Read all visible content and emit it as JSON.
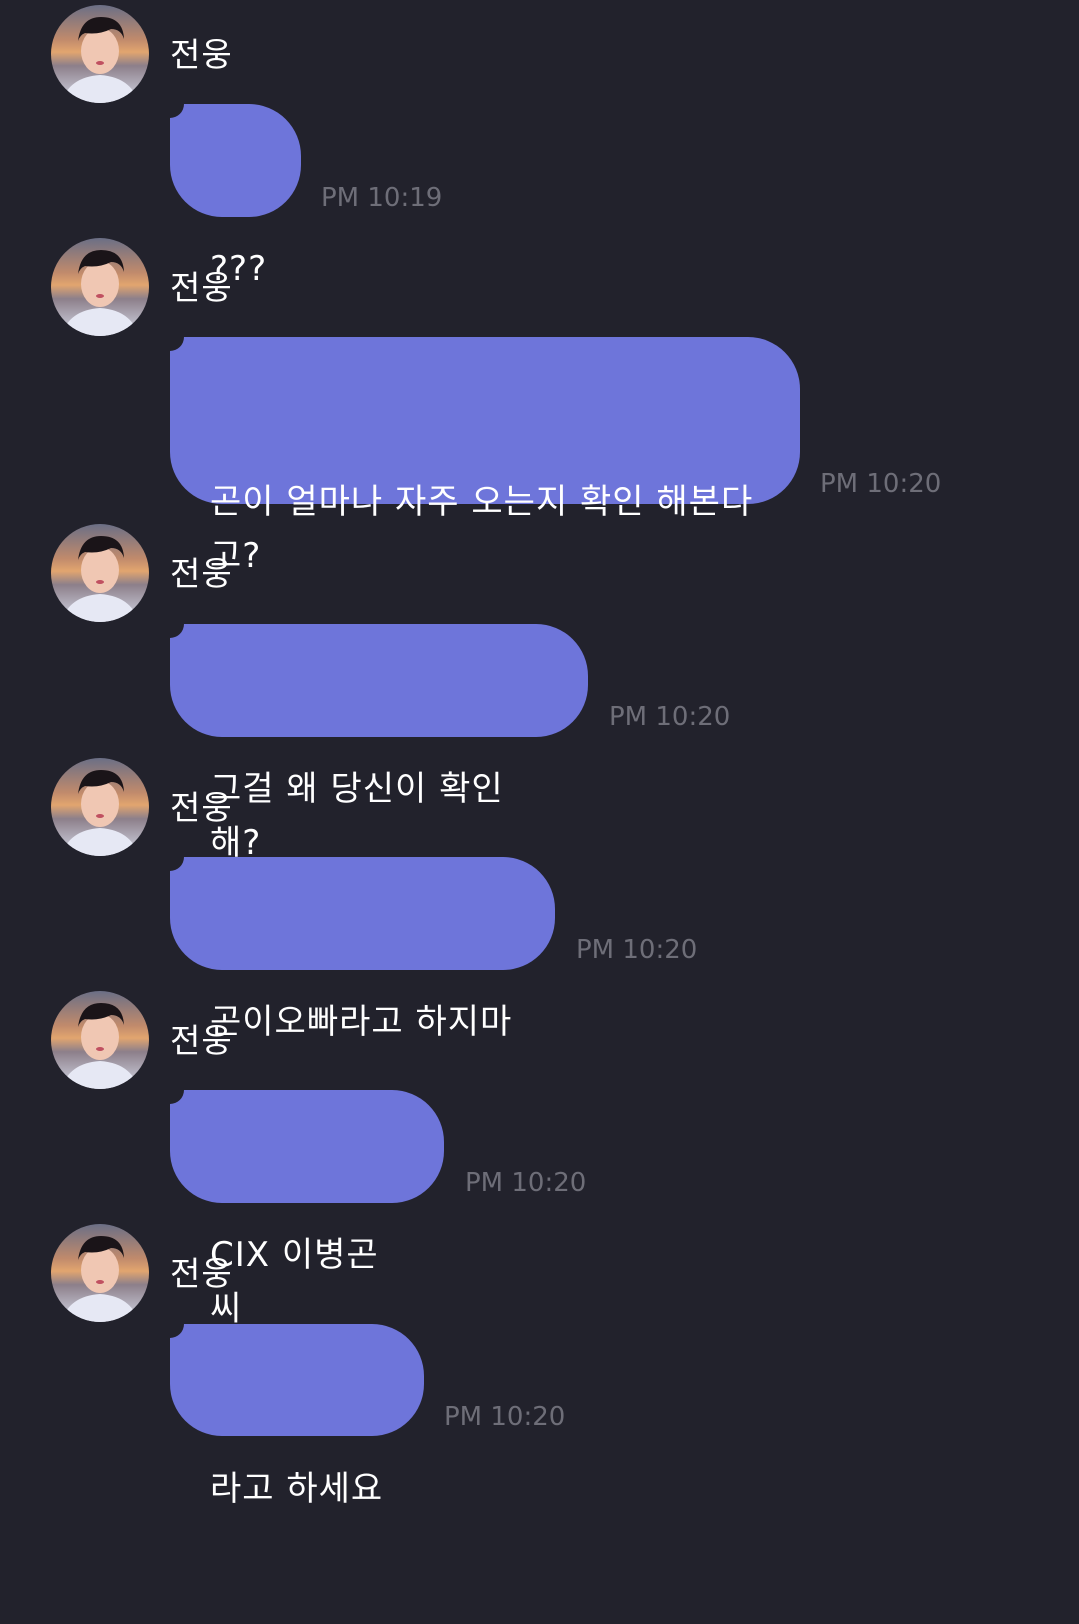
{
  "messages": [
    {
      "sender": "전웅",
      "text": "???",
      "time": "PM 10:19"
    },
    {
      "sender": "전웅",
      "text": "곤이 얼마나 자주 오는지 확인 해본다\n고?",
      "time": "PM 10:20"
    },
    {
      "sender": "전웅",
      "text": "그걸 왜 당신이 확인해?",
      "time": "PM 10:20"
    },
    {
      "sender": "전웅",
      "text": "곤이오빠라고 하지마",
      "time": "PM 10:20"
    },
    {
      "sender": "전웅",
      "text": "CIX 이병곤씨",
      "time": "PM 10:20"
    },
    {
      "sender": "전웅",
      "text": "라고 하세요",
      "time": "PM 10:20"
    }
  ],
  "colors": {
    "background": "#22222c",
    "bubble": "#6e75da",
    "timestamp": "#6e6e78",
    "name": "#ffffff"
  },
  "icons": {
    "avatar": "profile-photo"
  }
}
